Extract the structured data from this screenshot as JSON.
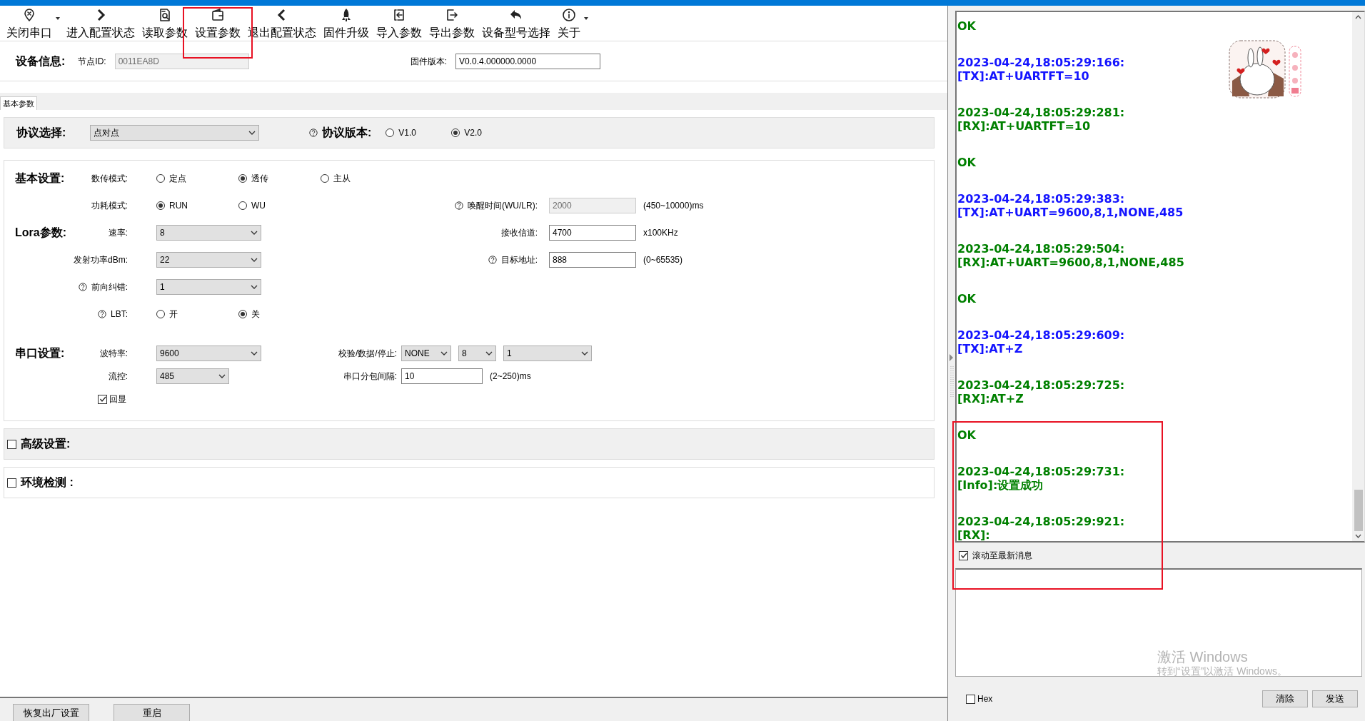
{
  "toolbar": {
    "items": [
      {
        "label": "关闭串口",
        "dropdown": true,
        "highlighted": false
      },
      {
        "label": "进入配置状态",
        "dropdown": false,
        "highlighted": false
      },
      {
        "label": "读取参数",
        "dropdown": false,
        "highlighted": false
      },
      {
        "label": "设置参数",
        "dropdown": false,
        "highlighted": true
      },
      {
        "label": "退出配置状态",
        "dropdown": false,
        "highlighted": false
      },
      {
        "label": "固件升级",
        "dropdown": false,
        "highlighted": false
      },
      {
        "label": "导入参数",
        "dropdown": false,
        "highlighted": false
      },
      {
        "label": "导出参数",
        "dropdown": false,
        "highlighted": false
      },
      {
        "label": "设备型号选择",
        "dropdown": false,
        "highlighted": false
      },
      {
        "label": "关于",
        "dropdown": true,
        "highlighted": false
      }
    ]
  },
  "device_info": {
    "title": "设备信息:",
    "fields": [
      {
        "label": "节点ID:",
        "value": "0011EA8D",
        "disabled": true
      },
      {
        "label": "固件版本:",
        "value": "V0.0.4.000000.0000",
        "disabled": false
      }
    ]
  },
  "tabs": [
    {
      "label": "基本参数",
      "selected": true
    }
  ],
  "protocol": {
    "title": "协议选择:",
    "select": "点对点",
    "version_label": "协议版本:",
    "version_help": true,
    "versions": [
      {
        "label": "V1.0",
        "selected": false
      },
      {
        "label": "V2.0",
        "selected": true
      }
    ]
  },
  "groups": [
    {
      "title": "基本设置:",
      "rows": [
        {
          "left": [
            {
              "kind": "label",
              "text": "数传模式:",
              "help": false
            },
            {
              "kind": "radios",
              "options": [
                {
                  "label": "定点",
                  "selected": false
                },
                {
                  "label": "透传",
                  "selected": true
                },
                {
                  "label": "主从",
                  "selected": false
                }
              ]
            }
          ],
          "right": []
        },
        {
          "left": [
            {
              "kind": "label",
              "text": "功耗模式:",
              "help": false
            },
            {
              "kind": "radios",
              "options": [
                {
                  "label": "RUN",
                  "selected": true
                },
                {
                  "label": "WU",
                  "selected": false
                }
              ]
            }
          ],
          "right": [
            {
              "kind": "label",
              "text": "唤醒时间(WU/LR):",
              "help": true
            },
            {
              "kind": "input",
              "value": "2000",
              "disabled": true
            },
            {
              "kind": "hint",
              "text": "(450~10000)ms"
            }
          ]
        }
      ]
    },
    {
      "title": "Lora参数:",
      "rows": [
        {
          "left": [
            {
              "kind": "label",
              "text": "速率:",
              "help": false
            },
            {
              "kind": "select",
              "value": "8"
            }
          ],
          "right": [
            {
              "kind": "label",
              "text": "接收信道:",
              "help": false
            },
            {
              "kind": "input",
              "value": "4700",
              "disabled": false
            },
            {
              "kind": "hint",
              "text": "x100KHz"
            }
          ]
        },
        {
          "left": [
            {
              "kind": "label",
              "text": "发射功率dBm:",
              "help": false
            },
            {
              "kind": "select",
              "value": "22"
            }
          ],
          "right": [
            {
              "kind": "label",
              "text": "目标地址:",
              "help": true
            },
            {
              "kind": "input",
              "value": "888",
              "disabled": false
            },
            {
              "kind": "hint",
              "text": "(0~65535)"
            }
          ]
        },
        {
          "left": [
            {
              "kind": "label",
              "text": "前向纠错:",
              "help": true
            },
            {
              "kind": "select",
              "value": "1"
            }
          ],
          "right": []
        },
        {
          "left": [
            {
              "kind": "label",
              "text": "LBT:",
              "help": true
            },
            {
              "kind": "radios",
              "options": [
                {
                  "label": "开",
                  "selected": false
                },
                {
                  "label": "关",
                  "selected": true
                }
              ]
            }
          ],
          "right": []
        }
      ]
    },
    {
      "title": "串口设置:",
      "rows": [
        {
          "left": [
            {
              "kind": "label",
              "text": "波特率:",
              "help": false
            },
            {
              "kind": "select",
              "value": "9600"
            }
          ],
          "right": [
            {
              "kind": "label",
              "text": "校验/数据/停止:",
              "help": false
            },
            {
              "kind": "select",
              "value": "NONE"
            },
            {
              "kind": "select",
              "value": "8"
            },
            {
              "kind": "select",
              "value": "1"
            }
          ]
        },
        {
          "left": [
            {
              "kind": "label",
              "text": "流控:",
              "help": false
            },
            {
              "kind": "select",
              "value": "485"
            }
          ],
          "right": [
            {
              "kind": "label",
              "text": "串口分包间隔:",
              "help": false
            },
            {
              "kind": "input",
              "value": "10",
              "disabled": false
            },
            {
              "kind": "hint",
              "text": "(2~250)ms"
            }
          ]
        },
        {
          "left": [
            {
              "kind": "checkbox",
              "label": "回显",
              "checked": true
            }
          ],
          "right": []
        }
      ]
    }
  ],
  "advanced": {
    "label": "高级设置:",
    "checked": false
  },
  "environment": {
    "label": "环境检测 :",
    "checked": false
  },
  "footer_buttons": [
    "恢复出厂设置",
    "重启"
  ],
  "log": [
    {
      "kind": "received",
      "lines": [
        "OK"
      ],
      "highlighted": false
    },
    {
      "kind": "sent",
      "lines": [
        "2023-04-24,18:05:29:166:",
        "[TX]:AT+UARTFT=10"
      ],
      "highlighted": false
    },
    {
      "kind": "received",
      "lines": [
        "2023-04-24,18:05:29:281:",
        "[RX]:AT+UARTFT=10"
      ],
      "highlighted": false
    },
    {
      "kind": "received",
      "lines": [
        "OK"
      ],
      "highlighted": false
    },
    {
      "kind": "sent",
      "lines": [
        "2023-04-24,18:05:29:383:",
        "[TX]:AT+UART=9600,8,1,NONE,485"
      ],
      "highlighted": false
    },
    {
      "kind": "received",
      "lines": [
        "2023-04-24,18:05:29:504:",
        "[RX]:AT+UART=9600,8,1,NONE,485"
      ],
      "highlighted": false
    },
    {
      "kind": "received",
      "lines": [
        "OK"
      ],
      "highlighted": false
    },
    {
      "kind": "sent",
      "lines": [
        "2023-04-24,18:05:29:609:",
        "[TX]:AT+Z"
      ],
      "highlighted": false
    },
    {
      "kind": "received",
      "lines": [
        "2023-04-24,18:05:29:725:",
        "[RX]:AT+Z"
      ],
      "highlighted": false
    },
    {
      "kind": "received",
      "lines": [
        "OK"
      ],
      "highlighted": true
    },
    {
      "kind": "received",
      "lines": [
        "2023-04-24,18:05:29:731:",
        "[Info]:设置成功"
      ],
      "highlighted": true
    },
    {
      "kind": "received",
      "lines": [
        "2023-04-24,18:05:29:921:",
        "[RX]:"
      ],
      "highlighted": true
    }
  ],
  "scroll_latest": {
    "label": "滚动至最新消息",
    "checked": true
  },
  "hex": {
    "label": "Hex",
    "checked": false
  },
  "send_buttons": [
    "清除",
    "发送"
  ],
  "watermark": [
    "激活 Windows",
    "转到“设置”以激活 Windows。"
  ]
}
